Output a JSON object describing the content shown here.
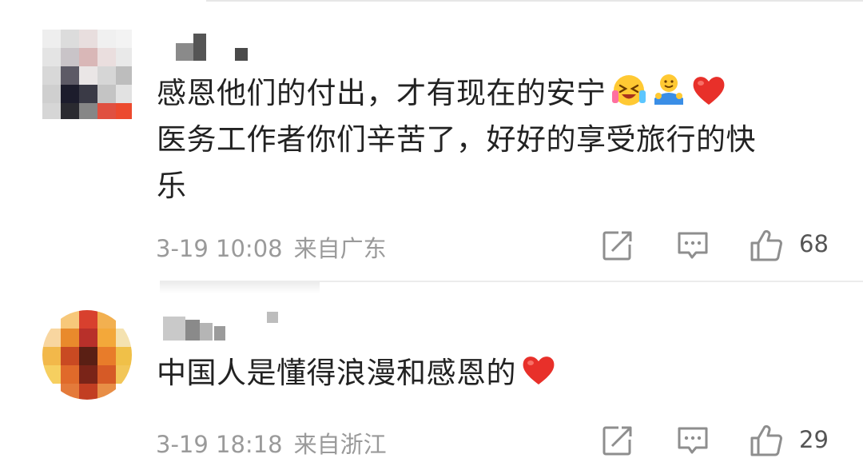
{
  "comments": [
    {
      "lines": [
        "感恩他们的付出，才有现在的安宁",
        "医务工作者你们辛苦了，好好的享受旅行的快",
        "乐"
      ],
      "emojis": [
        "laughing-tears-emoji",
        "hug-emoji",
        "red-heart-emoji"
      ],
      "date_time": "3-19 10:08",
      "location": "来自广东",
      "likes": "68"
    },
    {
      "lines": [
        "中国人是懂得浪漫和感恩的"
      ],
      "emojis": [
        "red-heart-emoji"
      ],
      "date_time": "3-19 18:18",
      "location": "来自浙江",
      "likes": "29"
    }
  ],
  "icons": {
    "repost": "repost-icon",
    "reply": "comment-icon",
    "like": "thumbs-up-icon"
  },
  "colors": {
    "text": "#222222",
    "meta": "#9a9a9a",
    "heart": "#e8302a",
    "icon": "#8e8e8e"
  }
}
